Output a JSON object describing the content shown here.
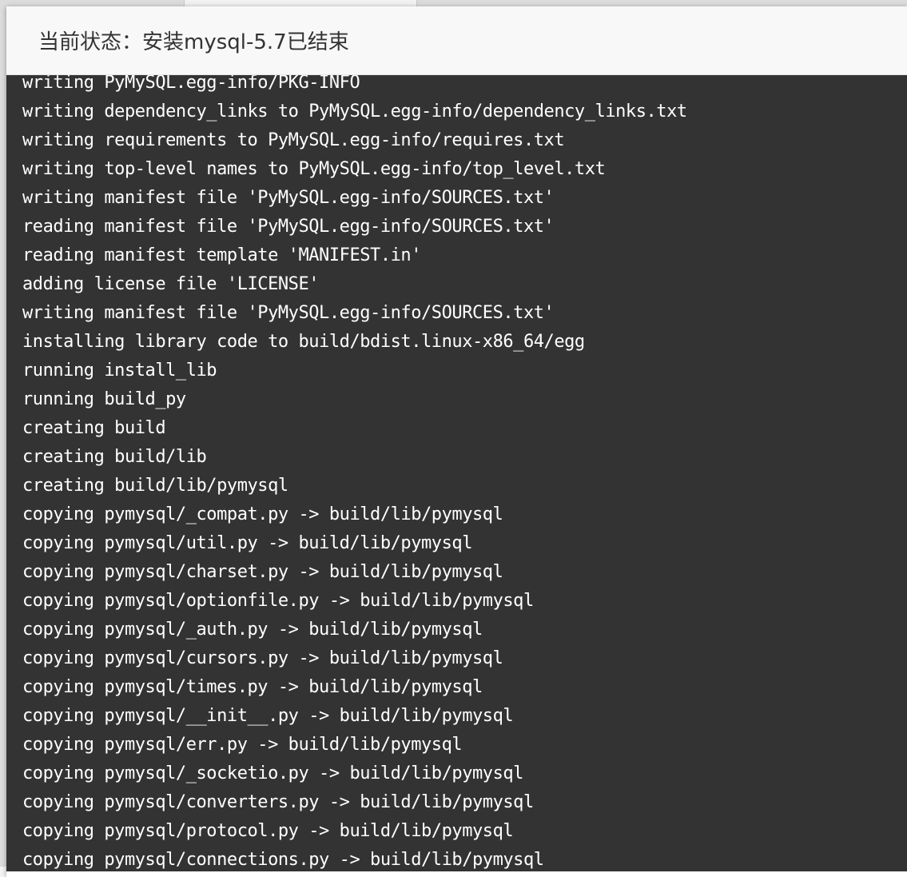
{
  "dialog": {
    "title": "当前状态：安装mysql-5.7已结束"
  },
  "console": {
    "lines": [
      "writing PyMySQL.egg-info/PKG-INFO",
      "writing dependency_links to PyMySQL.egg-info/dependency_links.txt",
      "writing requirements to PyMySQL.egg-info/requires.txt",
      "writing top-level names to PyMySQL.egg-info/top_level.txt",
      "writing manifest file 'PyMySQL.egg-info/SOURCES.txt'",
      "reading manifest file 'PyMySQL.egg-info/SOURCES.txt'",
      "reading manifest template 'MANIFEST.in'",
      "adding license file 'LICENSE'",
      "writing manifest file 'PyMySQL.egg-info/SOURCES.txt'",
      "installing library code to build/bdist.linux-x86_64/egg",
      "running install_lib",
      "running build_py",
      "creating build",
      "creating build/lib",
      "creating build/lib/pymysql",
      "copying pymysql/_compat.py -> build/lib/pymysql",
      "copying pymysql/util.py -> build/lib/pymysql",
      "copying pymysql/charset.py -> build/lib/pymysql",
      "copying pymysql/optionfile.py -> build/lib/pymysql",
      "copying pymysql/_auth.py -> build/lib/pymysql",
      "copying pymysql/cursors.py -> build/lib/pymysql",
      "copying pymysql/times.py -> build/lib/pymysql",
      "copying pymysql/__init__.py -> build/lib/pymysql",
      "copying pymysql/err.py -> build/lib/pymysql",
      "copying pymysql/_socketio.py -> build/lib/pymysql",
      "copying pymysql/converters.py -> build/lib/pymysql",
      "copying pymysql/protocol.py -> build/lib/pymysql",
      "copying pymysql/connections.py -> build/lib/pymysql"
    ]
  },
  "colors": {
    "console_background": "#333333",
    "console_text": "#ffffff",
    "header_background": "#f8f8f8",
    "title_text": "#333333"
  }
}
